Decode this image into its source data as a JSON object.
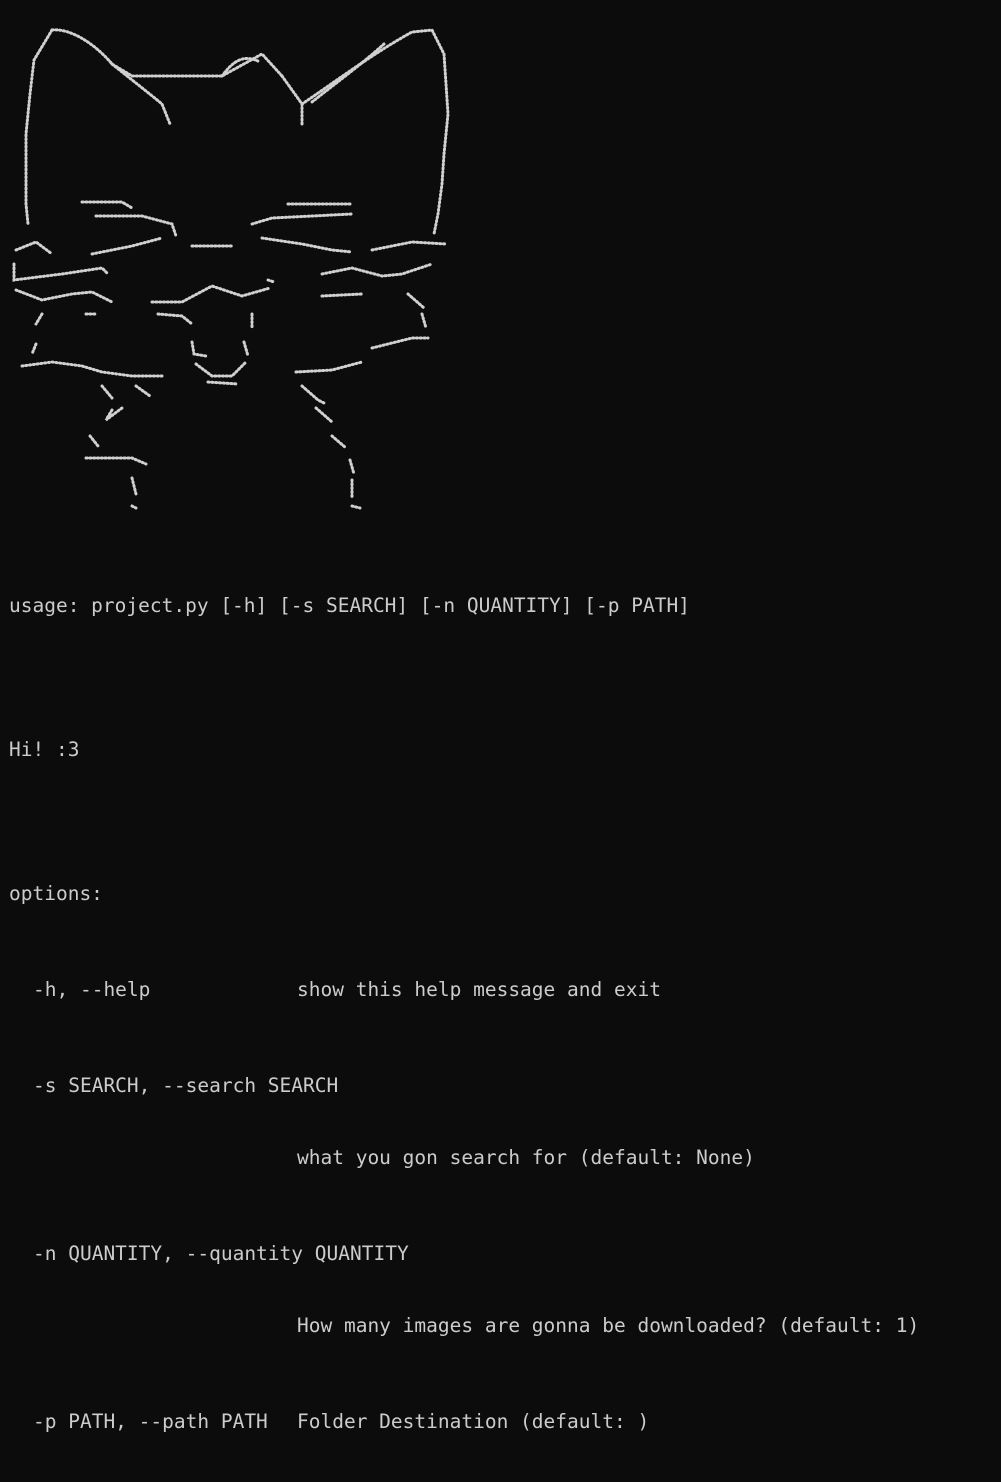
{
  "terminal": {
    "background": "#0c0c0c",
    "foreground": "#cccccc"
  },
  "ascii_art": {
    "icon": "cat-girl-braille-art"
  },
  "usage": {
    "line": "usage: project.py [-h] [-s SEARCH] [-n QUANTITY] [-p PATH]"
  },
  "description": "Hi! :3",
  "options": {
    "header": "options:",
    "items": [
      {
        "flags": "-h, --help",
        "desc": "show this help message and exit"
      },
      {
        "flags": "-s SEARCH, --search SEARCH",
        "desc": "what you gon search for (default: None)"
      },
      {
        "flags": "-n QUANTITY, --quantity QUANTITY",
        "desc": "How many images are gonna be downloaded? (default: 1)"
      },
      {
        "flags": "-p PATH, --path PATH",
        "desc": "Folder Destination (default: )"
      }
    ]
  }
}
